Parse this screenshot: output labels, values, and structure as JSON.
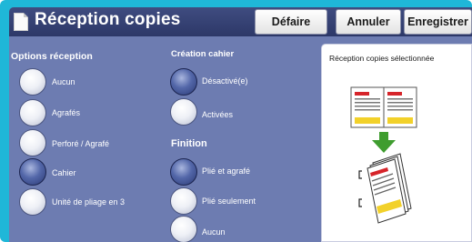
{
  "header": {
    "title": "Réception copies",
    "buttons": {
      "undo": "Défaire",
      "cancel": "Annuler",
      "save": "Enregistrer"
    }
  },
  "options_reception": {
    "title": "Options réception",
    "items": [
      {
        "label": "Aucun",
        "selected": false
      },
      {
        "label": "Agrafés",
        "selected": false
      },
      {
        "label": "Perforé / Agrafé",
        "selected": false
      },
      {
        "label": "Cahier",
        "selected": true
      },
      {
        "label": "Unité de pliage en 3",
        "selected": false
      }
    ]
  },
  "creation_cahier": {
    "title": "Création cahier",
    "items": [
      {
        "label": "Désactivé(e)",
        "selected": true
      },
      {
        "label": "Activées",
        "selected": false
      }
    ]
  },
  "finition": {
    "title": "Finition",
    "items": [
      {
        "label": "Plié et agrafé",
        "selected": true
      },
      {
        "label": "Plié seulement",
        "selected": false
      },
      {
        "label": "Aucun",
        "selected": false
      }
    ]
  },
  "preview": {
    "caption": "Réception copies sélectionnée",
    "icons": [
      "open-pages-icon",
      "arrow-down-icon",
      "booklet-icon"
    ],
    "colors": {
      "accent_red": "#d6242a",
      "accent_yellow": "#f2d12a",
      "arrow_green": "#3f9d2f"
    }
  },
  "colors": {
    "frame": "#1fb7d8",
    "panel": "#6d7cb1",
    "header": "#2d3868",
    "radio_selected": "#3b4d91"
  }
}
